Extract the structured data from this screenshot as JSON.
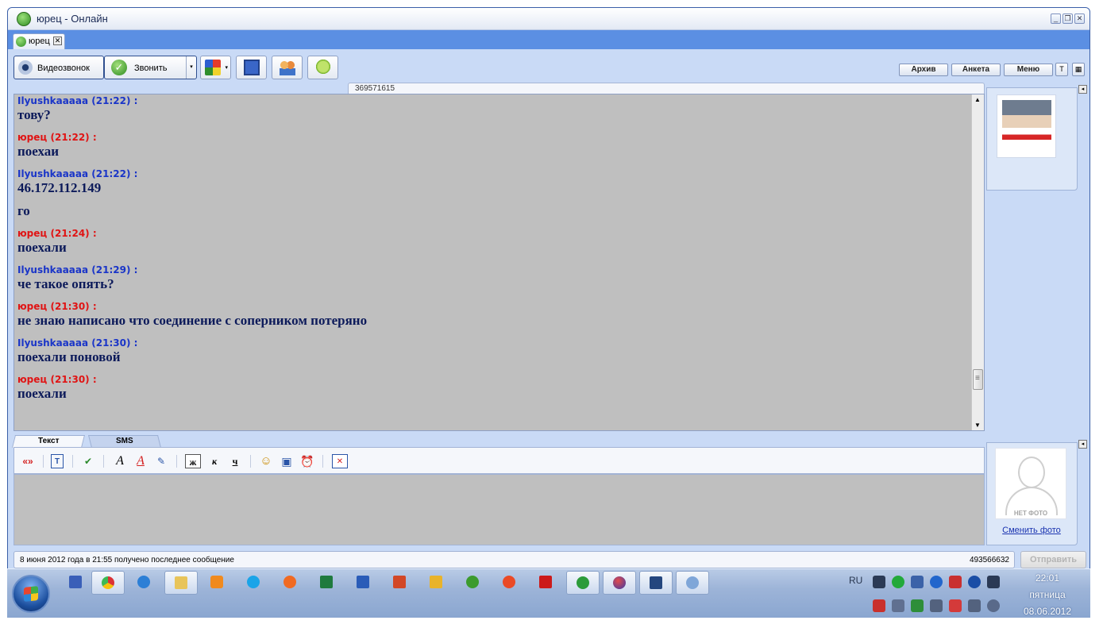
{
  "window": {
    "title": "юрец - Онлайн",
    "controls": {
      "minimize": "_",
      "restore": "❐",
      "close": "✕"
    }
  },
  "tabs": [
    {
      "label": "юрец",
      "close": "✕"
    }
  ],
  "toolbar": {
    "video_call_label": "Видеозвонок",
    "call_label": "Звонить",
    "call_dropdown": "▾",
    "caret": "▾"
  },
  "header_buttons": {
    "archive": "Архив",
    "profile": "Анкета",
    "menu": "Меню",
    "pin": "T",
    "grid": "▦"
  },
  "contact_uin": "369571615",
  "messages": [
    {
      "author": "Ilyushkaaaaa",
      "time": "(21:22) :",
      "color": "blue",
      "lines": [
        "тову?"
      ]
    },
    {
      "author": "юрец",
      "time": "(21:22) :",
      "color": "red",
      "lines": [
        "поехаи"
      ]
    },
    {
      "author": "Ilyushkaaaaa",
      "time": "(21:22) :",
      "color": "blue",
      "lines": [
        "46.172.112.149",
        "го"
      ]
    },
    {
      "author": "юрец",
      "time": "(21:24) :",
      "color": "red",
      "lines": [
        "поехали"
      ]
    },
    {
      "author": "Ilyushkaaaaa",
      "time": "(21:29) :",
      "color": "blue",
      "lines": [
        "че такое опять?"
      ]
    },
    {
      "author": "юрец",
      "time": "(21:30) :",
      "color": "red",
      "lines": [
        "не знаю написано что соединение с соперником потеряно"
      ]
    },
    {
      "author": "Ilyushkaaaaa",
      "time": "(21:30) :",
      "color": "blue",
      "lines": [
        "поехали поновой"
      ]
    },
    {
      "author": "юрец",
      "time": "(21:30) :",
      "color": "red",
      "lines": [
        "поехали"
      ]
    }
  ],
  "colors": {
    "author_blue": "#1a35c8",
    "author_red": "#e01414",
    "message_text": "#0c1a5a",
    "chat_bg": "#bfbfbf",
    "window_blue": "#5b8fe3"
  },
  "input_tabs": {
    "text": "Текст",
    "sms": "SMS"
  },
  "format_bar": {
    "translit": "«»",
    "bold": "ж",
    "italic": "к",
    "underline": "ч"
  },
  "right_panel": {
    "nophoto_label": "НЕТ ФОТО",
    "change_photo": "Сменить фото",
    "collapse": "◂"
  },
  "status": {
    "last_message": "8 июня 2012 года в 21:55 получено последнее сообщение",
    "my_uin": "493566632",
    "send_label": "Отправить"
  },
  "taskbar": {
    "language": "RU",
    "time": "22:01",
    "weekday": "пятница",
    "date": "08.06.2012"
  }
}
